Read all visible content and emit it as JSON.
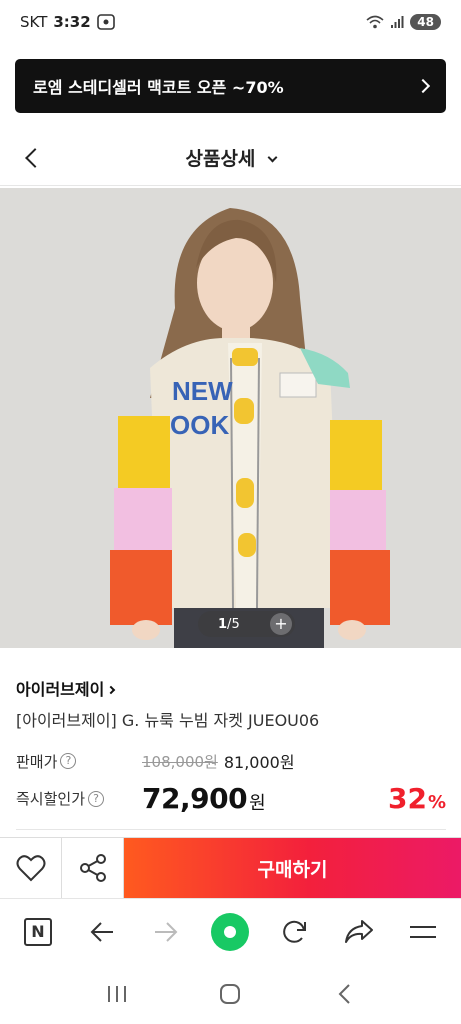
{
  "status_bar": {
    "carrier": "SKT",
    "time": "3:32",
    "battery": "48"
  },
  "promo_banner": {
    "text": "로엠 스테디셀러 맥코트 오픈 ~70%"
  },
  "header": {
    "title": "상품상세"
  },
  "gallery": {
    "current": "1",
    "separator": "/",
    "total": "5",
    "plus_symbol": "+"
  },
  "product": {
    "brand": "아이러브제이",
    "title": "[아이러브제이] G. 뉴룩 누빔 자켓 JUEOU06",
    "price_label": "판매가",
    "original_price": "108,000원",
    "sale_price": "81,000원",
    "instant_label": "즉시할인가",
    "instant_price": "72,900",
    "currency": "원",
    "discount_rate": "32",
    "discount_unit": "%"
  },
  "action_bar": {
    "buy_label": "구매하기"
  },
  "browser_bar": {
    "naver_label": "N"
  },
  "icons": {
    "question": "?",
    "wish": "heart-icon",
    "share": "share-icon"
  },
  "colors": {
    "buy_gradient_start": "#ff5a1f",
    "buy_gradient_end": "#ec1a66",
    "discount": "#f0202c",
    "accent_green": "#18c964"
  }
}
